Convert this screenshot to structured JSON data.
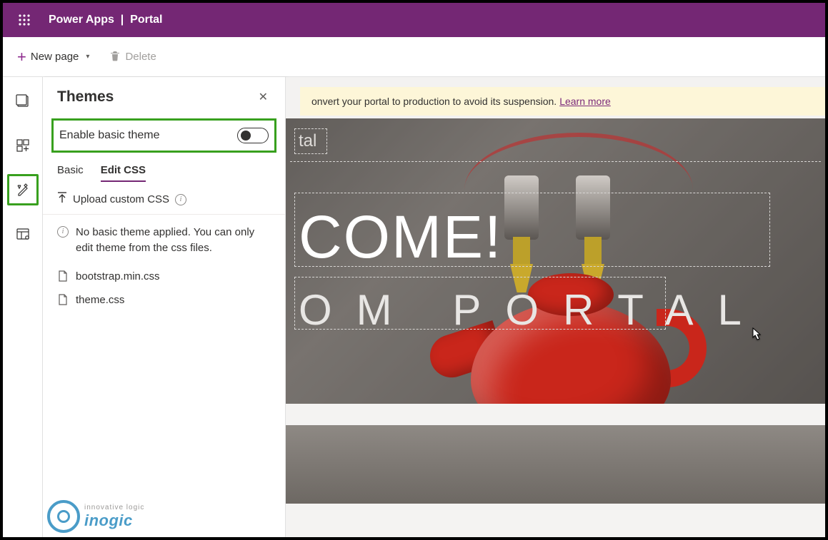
{
  "header": {
    "app": "Power Apps",
    "section": "Portal"
  },
  "commandbar": {
    "new_page": "New page",
    "delete": "Delete"
  },
  "rail": {
    "pages": "pages-icon",
    "components": "components-icon",
    "themes": "themes-icon",
    "templates": "templates-icon"
  },
  "panel": {
    "title": "Themes",
    "enable_label": "Enable basic theme",
    "enable_state": false,
    "tabs": {
      "basic": "Basic",
      "editcss": "Edit CSS",
      "active": "editcss"
    },
    "upload_label": "Upload custom CSS",
    "info_msg": "No basic theme applied. You can only edit theme from the css files.",
    "files": [
      "bootstrap.min.css",
      "theme.css"
    ]
  },
  "canvas": {
    "notification_text": "onvert your portal to production to avoid its suspension.",
    "notification_link": "Learn more",
    "hero_partial_tag": "tal",
    "hero_headline": "COME!",
    "hero_subline": "OM PORTAL"
  },
  "watermark": {
    "tag": "innovative logic",
    "brand": "inogic"
  }
}
